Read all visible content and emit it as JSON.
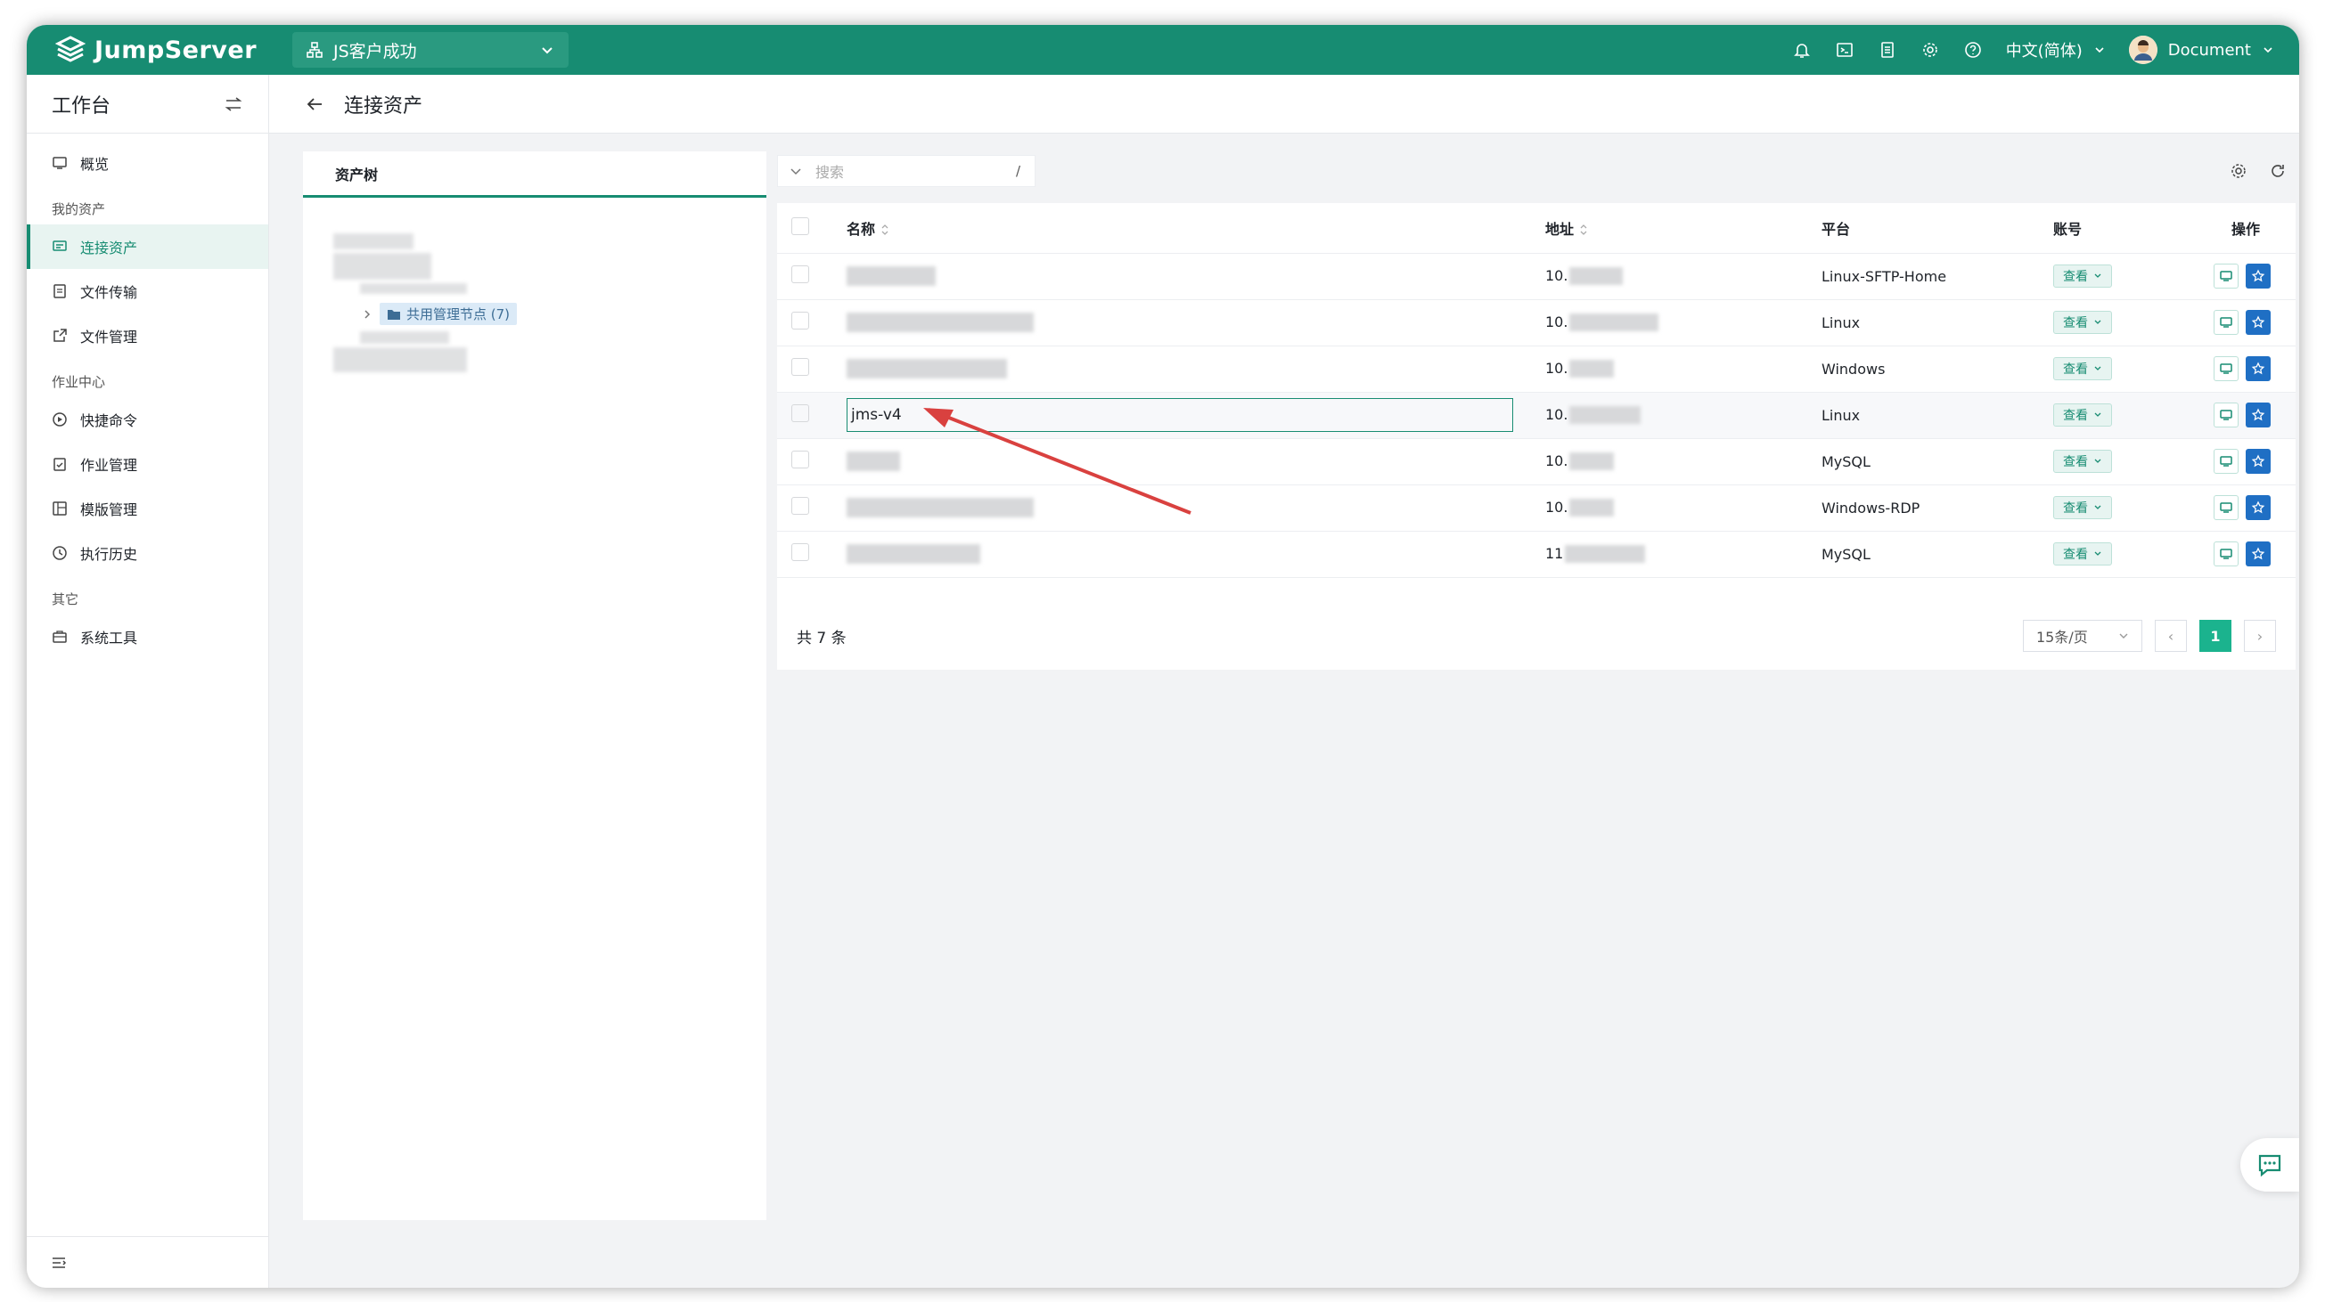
{
  "header": {
    "logo_text": "JumpServer",
    "org": "JS客户成功",
    "language": "中文(简体)",
    "user": "Document"
  },
  "sidebar": {
    "title": "工作台",
    "overview": "概览",
    "groups": [
      {
        "label": "我的资产",
        "items": [
          "连接资产",
          "文件传输",
          "文件管理"
        ]
      },
      {
        "label": "作业中心",
        "items": [
          "快捷命令",
          "作业管理",
          "模版管理",
          "执行历史"
        ]
      },
      {
        "label": "其它",
        "items": [
          "系统工具"
        ]
      }
    ],
    "active": "连接资产"
  },
  "page": {
    "title": "连接资产"
  },
  "tree": {
    "tab": "资产树",
    "shared_node": "共用管理节点 (7)"
  },
  "toolbar": {
    "search_placeholder": "搜索",
    "search_hint": "/"
  },
  "table": {
    "columns": [
      "名称",
      "地址",
      "平台",
      "账号",
      "操作"
    ],
    "view_label": "查看",
    "rows": [
      {
        "name": "",
        "address": "10.",
        "platform": "Linux-SFTP-Home"
      },
      {
        "name": "",
        "address": "10.",
        "platform": "Linux"
      },
      {
        "name": "",
        "address": "10.",
        "platform": "Windows"
      },
      {
        "name": "jms-v4",
        "address": "10.",
        "platform": "Linux"
      },
      {
        "name": "",
        "address": "10.",
        "platform": "MySQL"
      },
      {
        "name": "",
        "address": "10.",
        "platform": "Windows-RDP"
      },
      {
        "name": "",
        "address": "11",
        "platform": "MySQL"
      }
    ]
  },
  "pagination": {
    "total": "共 7 条",
    "page_size": "15条/页",
    "current": "1"
  }
}
